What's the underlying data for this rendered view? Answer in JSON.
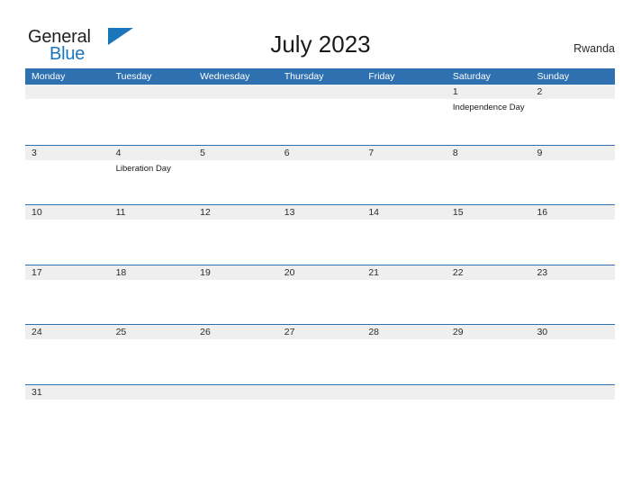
{
  "branding": {
    "logo_word_one": "General",
    "logo_word_two": "Blue",
    "logo_accent_color": "#1b75bb",
    "logo_text_color": "#231f20",
    "flag_icon": "triangle-flag-icon"
  },
  "header": {
    "title": "July 2023",
    "region": "Rwanda"
  },
  "theme": {
    "header_blue": "#2e70b0",
    "band_gray": "#efefef",
    "page_background": "#ffffff",
    "text_color": "#2b2b2b"
  },
  "calendar": {
    "month": "July",
    "year": "2023",
    "weekdays": [
      "Monday",
      "Tuesday",
      "Wednesday",
      "Thursday",
      "Friday",
      "Saturday",
      "Sunday"
    ],
    "weeks": [
      {
        "days": [
          {
            "date": "",
            "events": []
          },
          {
            "date": "",
            "events": []
          },
          {
            "date": "",
            "events": []
          },
          {
            "date": "",
            "events": []
          },
          {
            "date": "",
            "events": []
          },
          {
            "date": "1",
            "events": [
              "Independence Day"
            ]
          },
          {
            "date": "2",
            "events": []
          }
        ]
      },
      {
        "days": [
          {
            "date": "3",
            "events": []
          },
          {
            "date": "4",
            "events": [
              "Liberation Day"
            ]
          },
          {
            "date": "5",
            "events": []
          },
          {
            "date": "6",
            "events": []
          },
          {
            "date": "7",
            "events": []
          },
          {
            "date": "8",
            "events": []
          },
          {
            "date": "9",
            "events": []
          }
        ]
      },
      {
        "days": [
          {
            "date": "10",
            "events": []
          },
          {
            "date": "11",
            "events": []
          },
          {
            "date": "12",
            "events": []
          },
          {
            "date": "13",
            "events": []
          },
          {
            "date": "14",
            "events": []
          },
          {
            "date": "15",
            "events": []
          },
          {
            "date": "16",
            "events": []
          }
        ]
      },
      {
        "days": [
          {
            "date": "17",
            "events": []
          },
          {
            "date": "18",
            "events": []
          },
          {
            "date": "19",
            "events": []
          },
          {
            "date": "20",
            "events": []
          },
          {
            "date": "21",
            "events": []
          },
          {
            "date": "22",
            "events": []
          },
          {
            "date": "23",
            "events": []
          }
        ]
      },
      {
        "days": [
          {
            "date": "24",
            "events": []
          },
          {
            "date": "25",
            "events": []
          },
          {
            "date": "26",
            "events": []
          },
          {
            "date": "27",
            "events": []
          },
          {
            "date": "28",
            "events": []
          },
          {
            "date": "29",
            "events": []
          },
          {
            "date": "30",
            "events": []
          }
        ]
      },
      {
        "days": [
          {
            "date": "31",
            "events": []
          },
          {
            "date": "",
            "events": []
          },
          {
            "date": "",
            "events": []
          },
          {
            "date": "",
            "events": []
          },
          {
            "date": "",
            "events": []
          },
          {
            "date": "",
            "events": []
          },
          {
            "date": "",
            "events": []
          }
        ]
      }
    ]
  }
}
